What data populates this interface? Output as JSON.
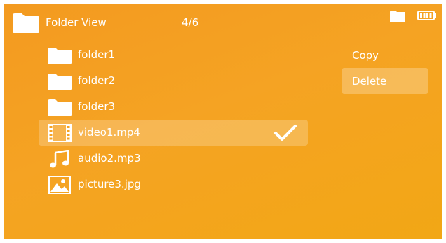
{
  "header": {
    "title": "Folder View",
    "counter": "4/6",
    "folder_icon": "folder-icon",
    "battery_icon": "battery-icon"
  },
  "files": [
    {
      "label": "folder1",
      "icon": "folder-icon",
      "selected": false
    },
    {
      "label": "folder2",
      "icon": "folder-icon",
      "selected": false
    },
    {
      "label": "folder3",
      "icon": "folder-icon",
      "selected": false
    },
    {
      "label": "video1.mp4",
      "icon": "film-icon",
      "selected": true,
      "checked": true
    },
    {
      "label": "audio2.mp3",
      "icon": "music-note-icon",
      "selected": false
    },
    {
      "label": "picture3.jpg",
      "icon": "image-icon",
      "selected": false
    }
  ],
  "menu": {
    "items": [
      {
        "label": "Copy",
        "active": false
      },
      {
        "label": "Delete",
        "active": true
      }
    ]
  },
  "colors": {
    "background": "#f5a323",
    "text": "#ffffff",
    "highlight": "rgba(255,255,255,0.22)"
  }
}
